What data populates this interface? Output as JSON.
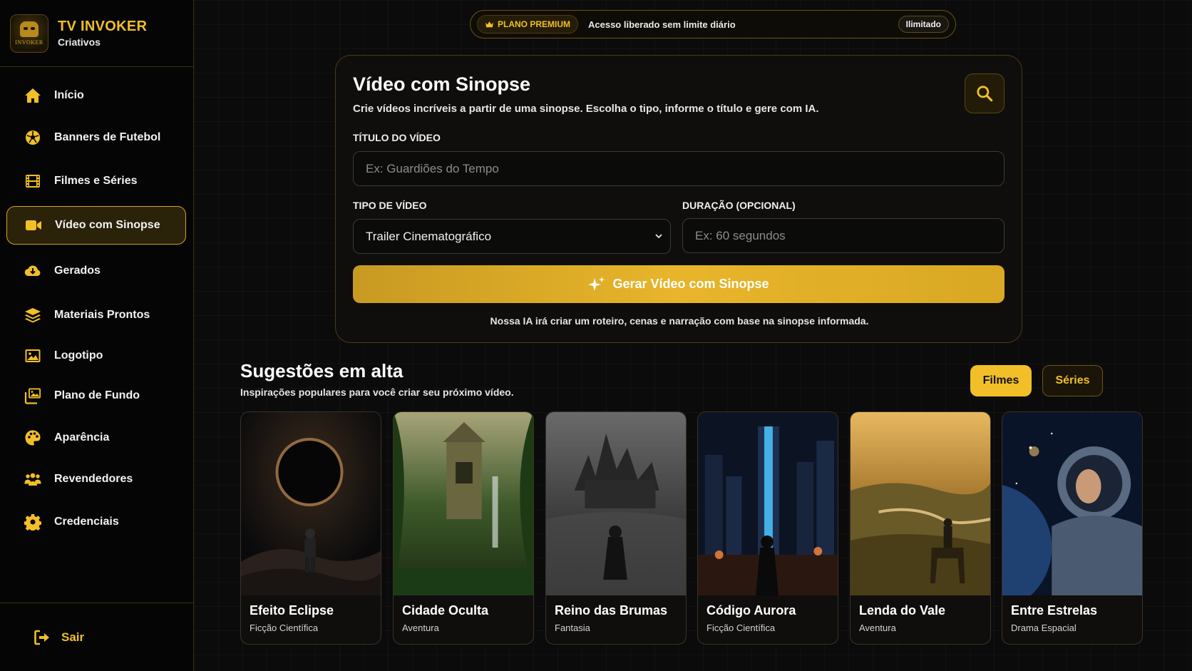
{
  "brand": {
    "title": "TV INVOKER",
    "subtitle": "Criativos",
    "logo_text": "INVOKER"
  },
  "nav": [
    {
      "label": "Início",
      "icon": "home-icon"
    },
    {
      "label": "Banners de Futebol",
      "icon": "soccer-ball-icon"
    },
    {
      "label": "Filmes e Séries",
      "icon": "film-icon"
    },
    {
      "label": "Vídeo com Sinopse",
      "icon": "video-camera-icon",
      "active": true
    },
    {
      "label": "Gerados",
      "icon": "cloud-download-icon"
    },
    {
      "label": "Materiais Prontos",
      "icon": "layers-icon"
    },
    {
      "label": "Logotipo",
      "icon": "image-icon"
    },
    {
      "label": "Plano de Fundo",
      "icon": "images-icon"
    },
    {
      "label": "Aparência",
      "icon": "palette-icon"
    },
    {
      "label": "Revendedores",
      "icon": "users-icon"
    },
    {
      "label": "Credenciais",
      "icon": "gear-icon"
    }
  ],
  "logout": {
    "label": "Sair",
    "icon": "logout-icon"
  },
  "premium": {
    "badge": "PLANO PREMIUM",
    "text": "Acesso liberado sem limite diário",
    "pill": "Ilimitado"
  },
  "form": {
    "title": "Vídeo com Sinopse",
    "subtitle": "Crie vídeos incríveis a partir de uma sinopse. Escolha o tipo, informe o título e gere com IA.",
    "title_label": "TÍTULO DO VÍDEO",
    "title_placeholder": "Ex: Guardiões do Tempo",
    "type_label": "TIPO DE VÍDEO",
    "type_value": "Trailer Cinematográfico",
    "duration_label": "DURAÇÃO (OPCIONAL)",
    "duration_placeholder": "Ex: 60 segundos",
    "generate_label": "Gerar Vídeo com Sinopse",
    "note": "Nossa IA irá criar um roteiro, cenas e narração com base na sinopse informada."
  },
  "suggestions": {
    "title": "Sugestões em alta",
    "subtitle": "Inspirações populares para você criar seu próximo vídeo.",
    "tabs": [
      {
        "label": "Filmes",
        "active": true
      },
      {
        "label": "Séries",
        "active": false
      }
    ],
    "items": [
      {
        "title": "Efeito Eclipse",
        "genre": "Ficção Científica"
      },
      {
        "title": "Cidade Oculta",
        "genre": "Aventura"
      },
      {
        "title": "Reino das Brumas",
        "genre": "Fantasia"
      },
      {
        "title": "Código Aurora",
        "genre": "Ficção Científica"
      },
      {
        "title": "Lenda do Vale",
        "genre": "Aventura"
      },
      {
        "title": "Entre Estrelas",
        "genre": "Drama Espacial"
      }
    ]
  },
  "colors": {
    "accent": "#f2bf28",
    "background": "#0b0b0b",
    "border": "#4a3c14"
  }
}
